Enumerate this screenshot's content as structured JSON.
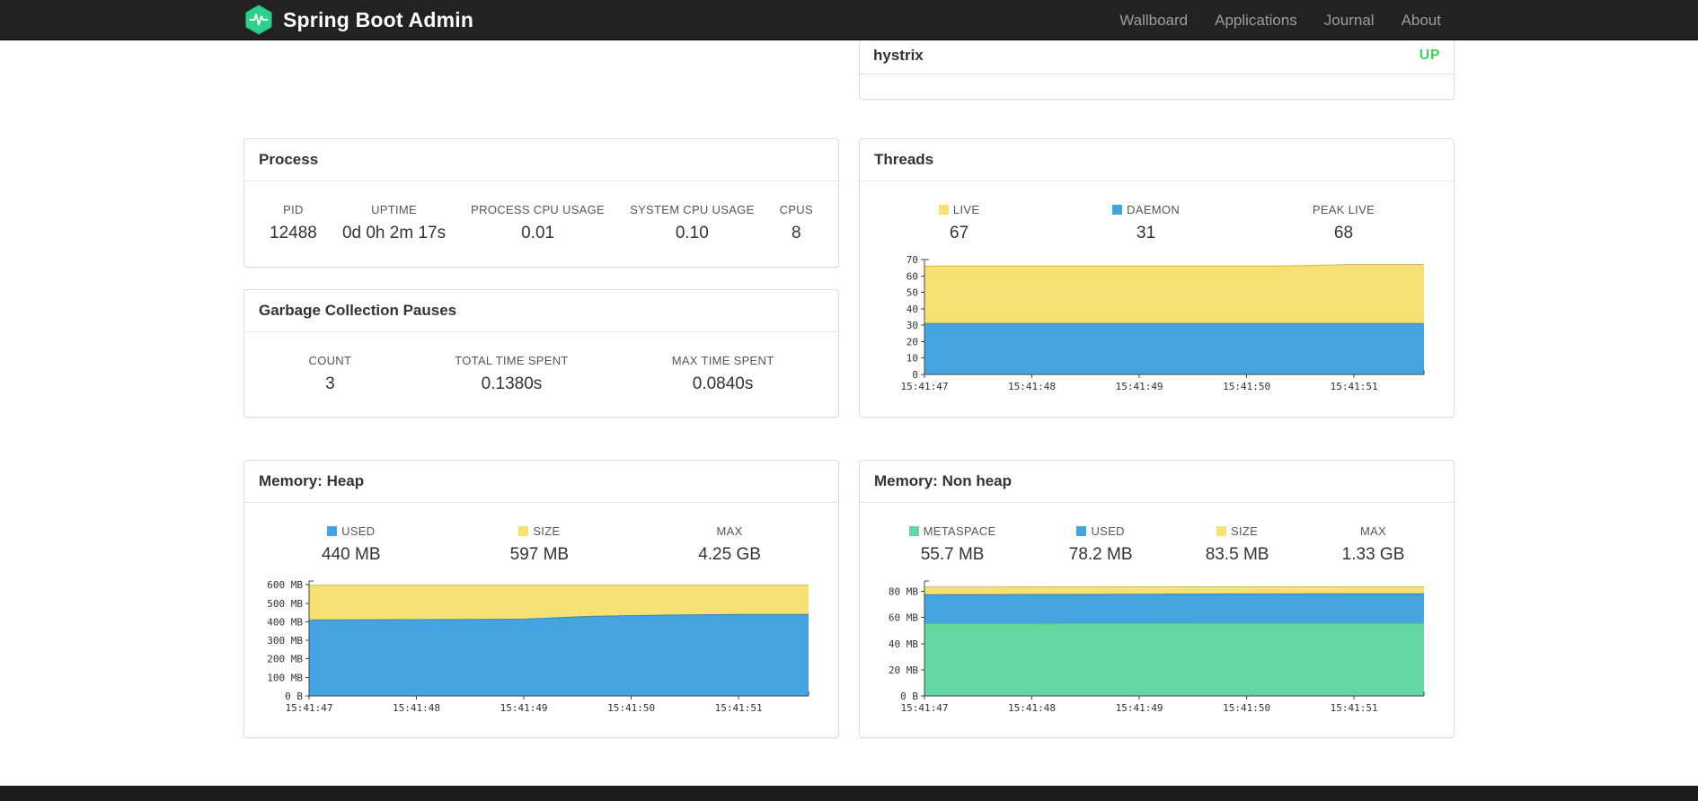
{
  "navbar": {
    "brand": "Spring Boot Admin",
    "links": [
      {
        "label": "Wallboard"
      },
      {
        "label": "Applications"
      },
      {
        "label": "Journal"
      },
      {
        "label": "About"
      }
    ]
  },
  "applications": {
    "row": {
      "name": "hystrix",
      "status": "UP",
      "status_color": "#3fd158"
    }
  },
  "panels": {
    "process": {
      "title": "Process",
      "stats": [
        {
          "label": "PID",
          "value": "12488"
        },
        {
          "label": "UPTIME",
          "value": "0d 0h 2m 17s"
        },
        {
          "label": "PROCESS CPU USAGE",
          "value": "0.01"
        },
        {
          "label": "SYSTEM CPU USAGE",
          "value": "0.10"
        },
        {
          "label": "CPUS",
          "value": "8"
        }
      ]
    },
    "gc": {
      "title": "Garbage Collection Pauses",
      "stats": [
        {
          "label": "COUNT",
          "value": "3"
        },
        {
          "label": "TOTAL TIME SPENT",
          "value": "0.1380s"
        },
        {
          "label": "MAX TIME SPENT",
          "value": "0.0840s"
        }
      ]
    },
    "threads": {
      "title": "Threads",
      "stats": [
        {
          "label": "LIVE",
          "value": "67",
          "swatch": "#f8e173"
        },
        {
          "label": "DAEMON",
          "value": "31",
          "swatch": "#45a3e0"
        },
        {
          "label": "PEAK LIVE",
          "value": "68"
        }
      ]
    },
    "heap": {
      "title": "Memory: Heap",
      "stats": [
        {
          "label": "USED",
          "value": "440 MB",
          "swatch": "#45a3e0"
        },
        {
          "label": "SIZE",
          "value": "597 MB",
          "swatch": "#f8e173"
        },
        {
          "label": "MAX",
          "value": "4.25 GB"
        }
      ]
    },
    "nonheap": {
      "title": "Memory: Non heap",
      "stats": [
        {
          "label": "METASPACE",
          "value": "55.7 MB",
          "swatch": "#64d6a3"
        },
        {
          "label": "USED",
          "value": "78.2 MB",
          "swatch": "#45a3e0"
        },
        {
          "label": "SIZE",
          "value": "83.5 MB",
          "swatch": "#f8e173"
        },
        {
          "label": "MAX",
          "value": "1.33 GB"
        }
      ]
    }
  },
  "chart_data": [
    {
      "id": "threads",
      "type": "area",
      "title": "Threads",
      "xlabel": "",
      "ylabel": "",
      "ylim": [
        0,
        70
      ],
      "x_labels": [
        "15:41:47",
        "15:41:48",
        "15:41:49",
        "15:41:50",
        "15:41:51"
      ],
      "yticks": [
        {
          "v": 0,
          "label": "0"
        },
        {
          "v": 10,
          "label": "10"
        },
        {
          "v": 20,
          "label": "20"
        },
        {
          "v": 30,
          "label": "30"
        },
        {
          "v": 40,
          "label": "40"
        },
        {
          "v": 50,
          "label": "50"
        },
        {
          "v": 60,
          "label": "60"
        },
        {
          "v": 70,
          "label": "70"
        }
      ],
      "series": [
        {
          "name": "LIVE",
          "color": "#f8e173",
          "values": [
            66,
            66,
            66,
            66,
            66,
            66,
            67,
            67
          ]
        },
        {
          "name": "DAEMON",
          "color": "#45a3e0",
          "values": [
            31,
            31,
            31,
            31,
            31,
            31,
            31,
            31
          ]
        }
      ],
      "legend_position": "top-stats",
      "grid": false
    },
    {
      "id": "memory-heap",
      "type": "area",
      "title": "Memory: Heap",
      "xlabel": "",
      "ylabel": "",
      "ylim": [
        0,
        620
      ],
      "x_labels": [
        "15:41:47",
        "15:41:48",
        "15:41:49",
        "15:41:50",
        "15:41:51"
      ],
      "yticks": [
        {
          "v": 0,
          "label": "0 B"
        },
        {
          "v": 100,
          "label": "100 MB"
        },
        {
          "v": 200,
          "label": "200 MB"
        },
        {
          "v": 300,
          "label": "300 MB"
        },
        {
          "v": 400,
          "label": "400 MB"
        },
        {
          "v": 500,
          "label": "500 MB"
        },
        {
          "v": 600,
          "label": "600 MB"
        }
      ],
      "series": [
        {
          "name": "SIZE",
          "color": "#f8e173",
          "values": [
            597,
            597,
            597,
            597,
            597,
            597,
            597,
            597
          ]
        },
        {
          "name": "USED",
          "color": "#45a3e0",
          "values": [
            410,
            411,
            412,
            414,
            430,
            436,
            440,
            440
          ]
        }
      ],
      "legend_position": "top-stats",
      "grid": false
    },
    {
      "id": "memory-nonheap",
      "type": "area",
      "title": "Memory: Non heap",
      "xlabel": "",
      "ylabel": "",
      "ylim": [
        0,
        88
      ],
      "x_labels": [
        "15:41:47",
        "15:41:48",
        "15:41:49",
        "15:41:50",
        "15:41:51"
      ],
      "yticks": [
        {
          "v": 0,
          "label": "0 B"
        },
        {
          "v": 20,
          "label": "20 MB"
        },
        {
          "v": 40,
          "label": "40 MB"
        },
        {
          "v": 60,
          "label": "60 MB"
        },
        {
          "v": 80,
          "label": "80 MB"
        }
      ],
      "series": [
        {
          "name": "SIZE",
          "color": "#f8e173",
          "values": [
            83.4,
            83.4,
            83.5,
            83.5,
            83.5,
            83.5,
            83.5,
            83.5
          ]
        },
        {
          "name": "USED",
          "color": "#45a3e0",
          "values": [
            77.5,
            77.6,
            77.7,
            77.8,
            78.0,
            78.1,
            78.2,
            78.2
          ]
        },
        {
          "name": "METASPACE",
          "color": "#64d6a3",
          "values": [
            55.5,
            55.5,
            55.6,
            55.6,
            55.7,
            55.7,
            55.7,
            55.7
          ]
        }
      ],
      "legend_position": "top-stats",
      "grid": false
    }
  ]
}
